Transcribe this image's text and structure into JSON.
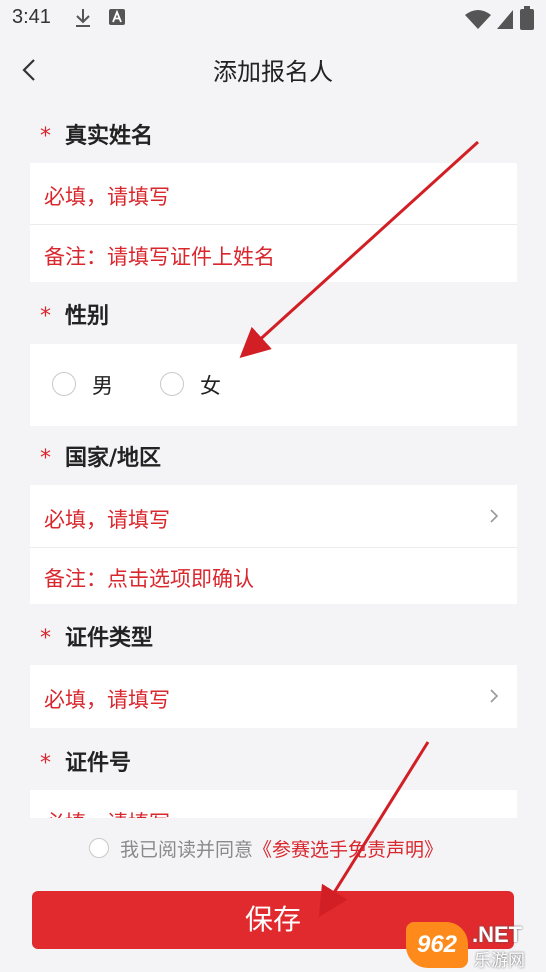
{
  "status": {
    "time": "3:41"
  },
  "header": {
    "title": "添加报名人"
  },
  "colors": {
    "accent": "#e02a2e",
    "required": "#d9272e",
    "background": "#f4f4f6"
  },
  "sections": {
    "name": {
      "label": "真实姓名",
      "placeholder": "必填，请填写",
      "note": "备注：请填写证件上姓名"
    },
    "gender": {
      "label": "性别",
      "options": [
        "男",
        "女"
      ]
    },
    "region": {
      "label": "国家/地区",
      "placeholder": "必填，请填写",
      "note": "备注：点击选项即确认"
    },
    "idtype": {
      "label": "证件类型",
      "placeholder": "必填，请填写"
    },
    "idnumber": {
      "label": "证件号",
      "placeholder": "必填，请填写"
    }
  },
  "required_mark": "*",
  "agreement": {
    "text": "我已阅读并同意",
    "link": "《参赛选手免责声明》"
  },
  "save_button": "保存",
  "watermark": {
    "logo": "962",
    "net": ".NET",
    "cn": "乐游网"
  }
}
